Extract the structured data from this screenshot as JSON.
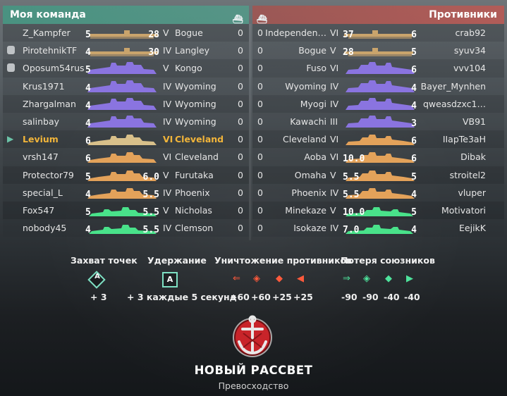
{
  "left_team": {
    "title": "Моя команда",
    "players": [
      {
        "name": "Z_Kampfer",
        "ship": "Bogue",
        "tier": "V",
        "score": "0",
        "lvl": "5",
        "cnt": "28",
        "cls": "carrier",
        "icon": ""
      },
      {
        "name": "PirotehnikTF",
        "ship": "Langley",
        "tier": "IV",
        "score": "0",
        "lvl": "4",
        "cnt": "30",
        "cls": "carrier",
        "icon": "shield"
      },
      {
        "name": "Oposum54rus",
        "ship": "Kongo",
        "tier": "V",
        "score": "0",
        "lvl": "5",
        "cnt": "",
        "cls": "battleship",
        "icon": "shield"
      },
      {
        "name": "Krus1971",
        "ship": "Wyoming",
        "tier": "IV",
        "score": "0",
        "lvl": "4",
        "cnt": "",
        "cls": "battleship",
        "icon": ""
      },
      {
        "name": "Zhargalman",
        "ship": "Wyoming",
        "tier": "IV",
        "score": "0",
        "lvl": "4",
        "cnt": "",
        "cls": "battleship",
        "icon": ""
      },
      {
        "name": "salinbay",
        "ship": "Wyoming",
        "tier": "IV",
        "score": "0",
        "lvl": "4",
        "cnt": "",
        "cls": "battleship",
        "icon": ""
      },
      {
        "name": "Levium",
        "ship": "Cleveland",
        "tier": "VI",
        "score": "0",
        "lvl": "6",
        "cnt": "",
        "cls": "cruiser-hl",
        "icon": "arrow",
        "hl": true
      },
      {
        "name": "vrsh147",
        "ship": "Cleveland",
        "tier": "VI",
        "score": "0",
        "lvl": "6",
        "cnt": "",
        "cls": "cruiser",
        "icon": ""
      },
      {
        "name": "Protector79",
        "ship": "Furutaka",
        "tier": "V",
        "score": "0",
        "lvl": "5",
        "cnt": "6.0",
        "cls": "cruiser",
        "icon": ""
      },
      {
        "name": "special_L",
        "ship": "Phoenix",
        "tier": "IV",
        "score": "0",
        "lvl": "4",
        "cnt": "5.5",
        "cls": "cruiser",
        "icon": ""
      },
      {
        "name": "Fox547",
        "ship": "Nicholas",
        "tier": "V",
        "score": "0",
        "lvl": "5",
        "cnt": "5.5",
        "cls": "destroyer",
        "icon": ""
      },
      {
        "name": "nobody45",
        "ship": "Clemson",
        "tier": "IV",
        "score": "0",
        "lvl": "4",
        "cnt": "5.5",
        "cls": "destroyer",
        "icon": ""
      }
    ]
  },
  "right_team": {
    "title": "Противники",
    "players": [
      {
        "name": "crab92",
        "ship": "Independen…",
        "tier": "VI",
        "score": "0",
        "lvl": "6",
        "cnt": "37",
        "cls": "carrier"
      },
      {
        "name": "syuv34",
        "ship": "Bogue",
        "tier": "V",
        "score": "0",
        "lvl": "5",
        "cnt": "28",
        "cls": "carrier"
      },
      {
        "name": "vvv104",
        "ship": "Fuso",
        "tier": "VI",
        "score": "0",
        "lvl": "6",
        "cnt": "",
        "cls": "battleship"
      },
      {
        "name": "Bayer_Mynhen",
        "ship": "Wyoming",
        "tier": "IV",
        "score": "0",
        "lvl": "4",
        "cnt": "",
        "cls": "battleship"
      },
      {
        "name": "qweasdzxc1…",
        "ship": "Myogi",
        "tier": "IV",
        "score": "0",
        "lvl": "4",
        "cnt": "",
        "cls": "battleship"
      },
      {
        "name": "VB91",
        "ship": "Kawachi",
        "tier": "III",
        "score": "0",
        "lvl": "3",
        "cnt": "",
        "cls": "battleship"
      },
      {
        "name": "IIapTe3aH",
        "ship": "Cleveland",
        "tier": "VI",
        "score": "0",
        "lvl": "6",
        "cnt": "",
        "cls": "cruiser"
      },
      {
        "name": "Dibak",
        "ship": "Aoba",
        "tier": "VI",
        "score": "0",
        "lvl": "6",
        "cnt": "10.0",
        "cls": "cruiser"
      },
      {
        "name": "stroitel2",
        "ship": "Omaha",
        "tier": "V",
        "score": "0",
        "lvl": "5",
        "cnt": "5.5",
        "cls": "cruiser"
      },
      {
        "name": "vluper",
        "ship": "Phoenix",
        "tier": "IV",
        "score": "0",
        "lvl": "4",
        "cnt": "5.5",
        "cls": "cruiser"
      },
      {
        "name": "Motivatori",
        "ship": "Minekaze",
        "tier": "V",
        "score": "0",
        "lvl": "5",
        "cnt": "10.0",
        "cls": "destroyer"
      },
      {
        "name": "EejikK",
        "ship": "Isokaze",
        "tier": "IV",
        "score": "0",
        "lvl": "4",
        "cnt": "7.0",
        "cls": "destroyer"
      }
    ]
  },
  "scoring": {
    "capture": {
      "title": "Захват точек",
      "value": "+ 3",
      "letter": "A"
    },
    "hold": {
      "title": "Удержание",
      "value": "+ 3 каждые 5 секунд",
      "letter": "A"
    },
    "kill": {
      "title": "Уничтожение противников",
      "values": [
        "+60",
        "+60",
        "+25",
        "+25"
      ]
    },
    "loss": {
      "title": "Потеря союзников",
      "values": [
        "-90",
        "-90",
        "-40",
        "-40"
      ]
    }
  },
  "mode": {
    "title": "НОВЫЙ РАССВЕТ",
    "subtitle": "Превосходство"
  },
  "colors": {
    "ally": "#4a9a84",
    "enemy": "#b4584f",
    "highlight": "#f2b53a",
    "carrier": "#c9a46c",
    "battleship": "#8a74e0",
    "cruiser": "#e3a25a",
    "cruiser_hl": "#d8c08a",
    "destroyer": "#49e28a"
  }
}
